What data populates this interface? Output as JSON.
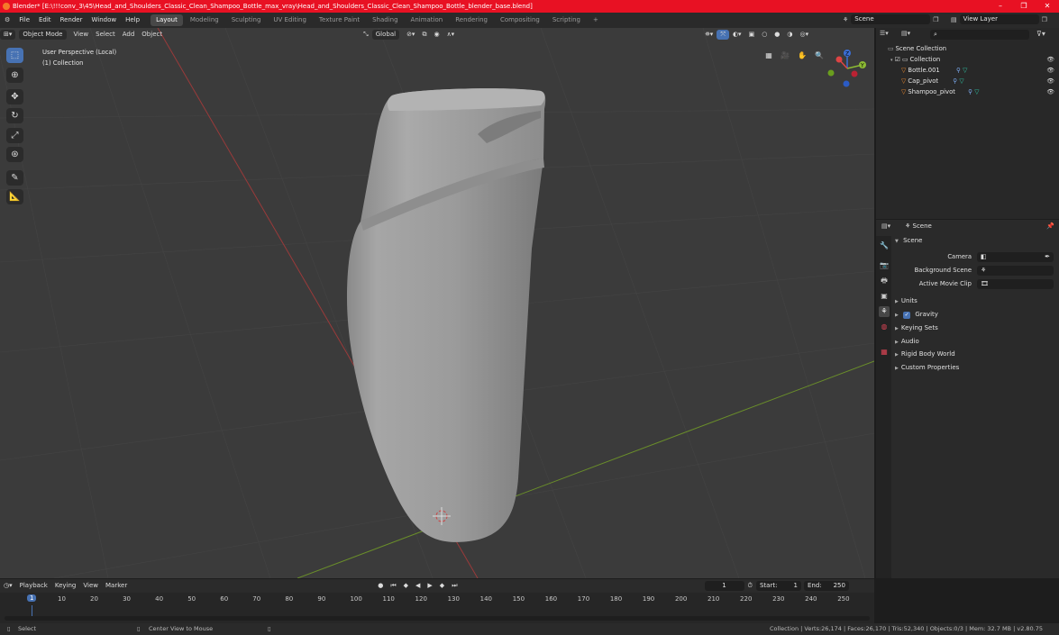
{
  "window": {
    "title": "Blender* [E:\\!!!conv_3\\45\\Head_and_Shoulders_Classic_Clean_Shampoo_Bottle_max_vray\\Head_and_Shoulders_Classic_Clean_Shampoo_Bottle_blender_base.blend]",
    "controls": [
      "–",
      "❐",
      "✕"
    ]
  },
  "menubar": {
    "menus": [
      "File",
      "Edit",
      "Render",
      "Window",
      "Help"
    ],
    "workspaces": [
      "Layout",
      "Modeling",
      "Sculpting",
      "UV Editing",
      "Texture Paint",
      "Shading",
      "Animation",
      "Rendering",
      "Compositing",
      "Scripting"
    ],
    "active_workspace": "Layout",
    "add_tab": "+",
    "scene_name": "Scene",
    "view_layer": "View Layer"
  },
  "viewport": {
    "mode": "Object Mode",
    "menus": [
      "View",
      "Select",
      "Add",
      "Object"
    ],
    "transform_orientation": "Global",
    "overlay_title": "User Perspective (Local)",
    "overlay_collection": "(1) Collection",
    "gizmo_axes": [
      "X",
      "Y",
      "Z"
    ],
    "colors": {
      "x_axis": "#9a3a3a",
      "y_axis": "#6a8e2a",
      "grid": "#444444",
      "active_tool": "#4772b3"
    }
  },
  "tools": [
    "select-box-icon",
    "cursor-icon",
    "move-icon",
    "rotate-icon",
    "scale-icon",
    "transform-icon",
    "annotate-icon",
    "measure-icon"
  ],
  "outliner": {
    "search_placeholder": "",
    "root": "Scene Collection",
    "collection": "Collection",
    "objects": [
      "Bottle.001",
      "Cap_pivot",
      "Shampoo_pivot"
    ]
  },
  "properties": {
    "breadcrumb": "Scene",
    "section": "Scene",
    "fields": [
      {
        "label": "Camera",
        "value": ""
      },
      {
        "label": "Background Scene",
        "value": ""
      },
      {
        "label": "Active Movie Clip",
        "value": ""
      }
    ],
    "panels": [
      "Units",
      "Gravity",
      "Keying Sets",
      "Audio",
      "Rigid Body World",
      "Custom Properties"
    ],
    "gravity_checked": true
  },
  "timeline": {
    "menus": [
      "Playback",
      "Keying",
      "View",
      "Marker"
    ],
    "current_frame": "1",
    "start_label": "Start:",
    "start": "1",
    "end_label": "End:",
    "end": "250",
    "ticks": [
      "1",
      "10",
      "20",
      "30",
      "40",
      "50",
      "60",
      "70",
      "80",
      "90",
      "100",
      "110",
      "120",
      "130",
      "140",
      "150",
      "160",
      "170",
      "180",
      "190",
      "200",
      "210",
      "220",
      "230",
      "240",
      "250"
    ]
  },
  "statusbar": {
    "left": "Select",
    "middle": "Center View to Mouse",
    "stats": "Collection | Verts:26,174 | Faces:26,170 | Tris:52,340 | Objects:0/3 | Mem: 32.7 MB | v2.80.75"
  }
}
